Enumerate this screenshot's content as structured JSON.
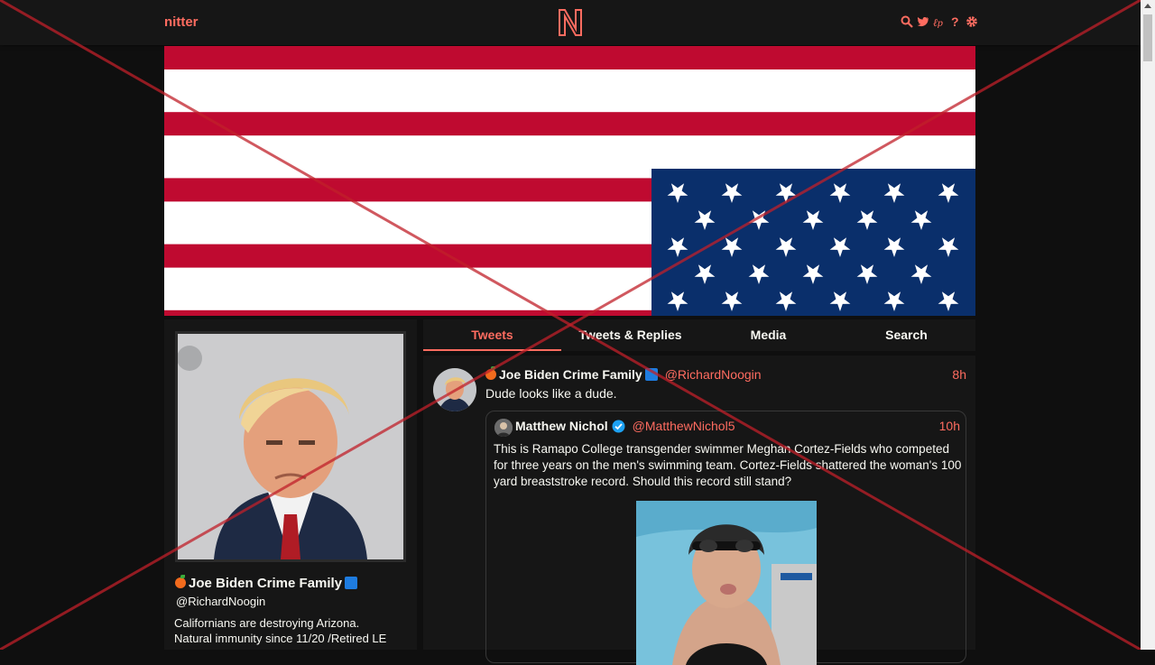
{
  "nav": {
    "brand": "nitter",
    "icons": [
      "search-icon",
      "twitter-bird-icon",
      "rss-icon",
      "help-icon",
      "gear-icon"
    ],
    "accent_color": "#ff6c60"
  },
  "profile": {
    "full_name": "Joe Biden Crime Family",
    "username": "@RichardNoogin",
    "bio_line1": "Californians are destroying Arizona.",
    "bio_line2": "Natural immunity since 11/20 /Retired LE"
  },
  "tabs": [
    {
      "label": "Tweets",
      "active": true
    },
    {
      "label": "Tweets & Replies",
      "active": false
    },
    {
      "label": "Media",
      "active": false
    },
    {
      "label": "Search",
      "active": false
    }
  ],
  "tweet": {
    "full_name": "Joe Biden Crime Family",
    "username": "@RichardNoogin",
    "date": "8h",
    "text": "Dude looks like a dude.",
    "quote": {
      "full_name": "Matthew Nichol",
      "username": "@MatthewNichol5",
      "date": "10h",
      "text": "This is Ramapo College transgender swimmer Meghan Cortez-Fields who competed for three years on the men's swimming team. Cortez-Fields shattered the woman's 100 yard breaststroke record. Should this record still stand?"
    }
  },
  "overlay": {
    "color": "#c0202a"
  }
}
